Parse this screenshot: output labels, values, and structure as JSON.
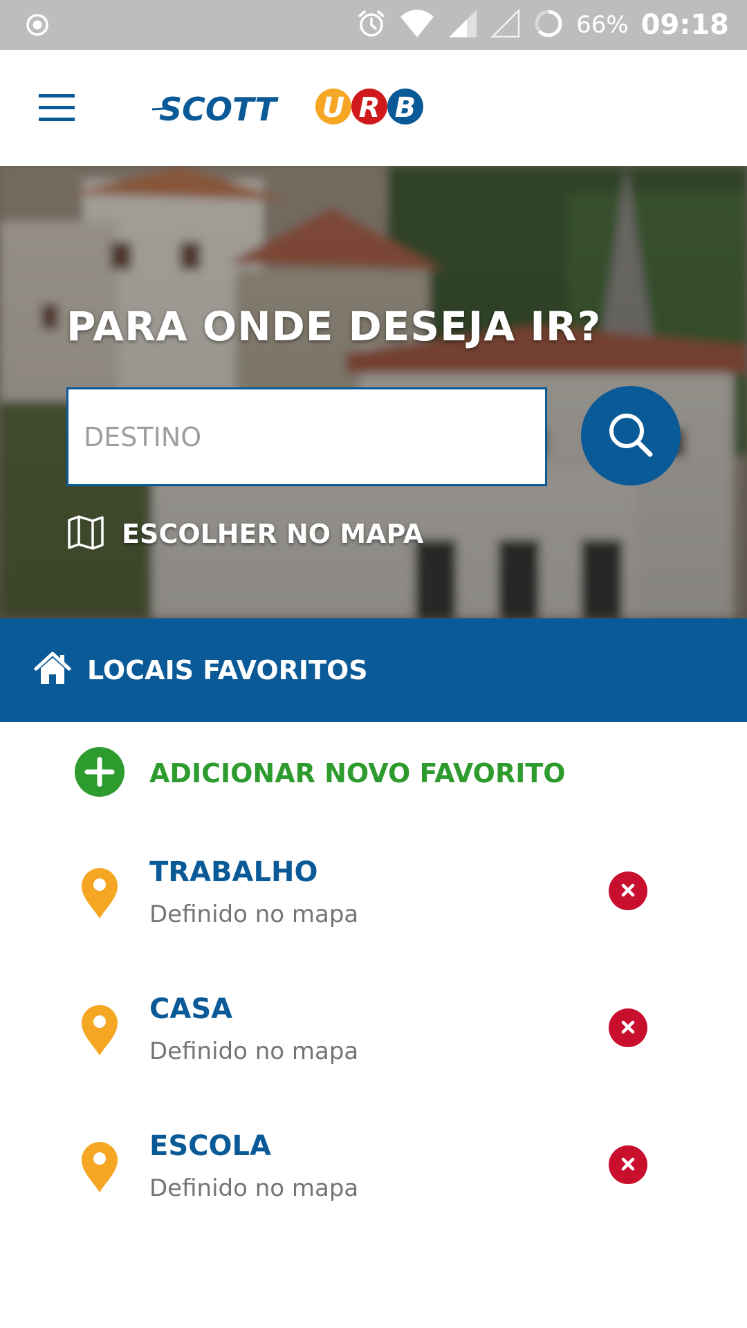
{
  "status_bar": {
    "battery_text": "66%",
    "time": "09:18",
    "icons": [
      "record-icon",
      "alarm-icon",
      "wifi-icon",
      "signal-icon",
      "signal-empty-icon",
      "battery-icon"
    ]
  },
  "app_bar": {
    "logo_text_left": "SCOTT",
    "logo_letters": [
      "U",
      "R",
      "B"
    ],
    "logo_colors": [
      "#f5a623",
      "#d0191c",
      "#0a5a98"
    ],
    "menu_icon": "hamburger-menu-icon"
  },
  "hero": {
    "title": "PARA ONDE DESEJA IR?",
    "destination_placeholder": "DESTINO",
    "destination_value": "",
    "search_icon": "search-icon",
    "map_icon": "map-icon",
    "map_choice_label": "ESCOLHER NO MAPA"
  },
  "favorites": {
    "header_icon": "home-icon",
    "header_label": "LOCAIS FAVORITOS",
    "add_label": "ADICIONAR NOVO FAVORITO",
    "items": [
      {
        "title": "TRABALHO",
        "subtitle": "Definido no mapa"
      },
      {
        "title": "CASA",
        "subtitle": "Definido no mapa"
      },
      {
        "title": "ESCOLA",
        "subtitle": "Definido no mapa"
      }
    ]
  },
  "colors": {
    "brand_blue": "#0a5a98",
    "add_green": "#2e9b2e",
    "pin_orange": "#f5a623",
    "remove_red": "#c8102e"
  }
}
